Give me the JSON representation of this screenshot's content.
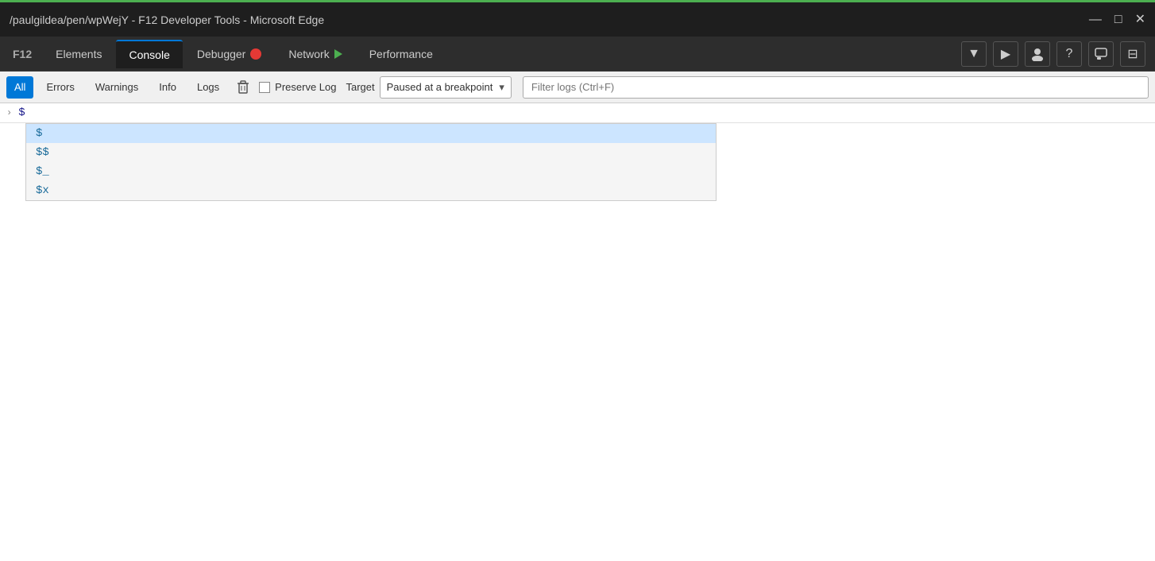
{
  "window": {
    "title": "/paulgildea/pen/wpWejY - F12 Developer Tools - Microsoft Edge",
    "controls": {
      "minimize": "—",
      "maximize": "□",
      "close": "✕"
    }
  },
  "tabs": [
    {
      "id": "f12",
      "label": "F12",
      "active": false
    },
    {
      "id": "elements",
      "label": "Elements",
      "active": false
    },
    {
      "id": "console",
      "label": "Console",
      "active": true
    },
    {
      "id": "debugger",
      "label": "Debugger",
      "active": false,
      "icon": "pause"
    },
    {
      "id": "network",
      "label": "Network",
      "active": false,
      "icon": "play"
    },
    {
      "id": "performance",
      "label": "Performance",
      "active": false
    }
  ],
  "toolbar_right": {
    "more_icon": "▼",
    "run_icon": "▶",
    "people_icon": "👤",
    "help_icon": "?",
    "feedback_icon": "💬",
    "layout_icon": "⊟"
  },
  "console_toolbar": {
    "all_label": "All",
    "errors_label": "Errors",
    "warnings_label": "Warnings",
    "info_label": "Info",
    "logs_label": "Logs",
    "clear_icon": "🗑",
    "preserve_log_label": "Preserve Log",
    "target_label": "Target",
    "target_value": "Paused at a breakpoint",
    "filter_placeholder": "Filter logs (Ctrl+F)"
  },
  "console_input": {
    "chevron": "›",
    "prompt": "$"
  },
  "autocomplete": {
    "items": [
      {
        "text": "$",
        "highlighted": true
      },
      {
        "text": "$$",
        "highlighted": false
      },
      {
        "text": "$_",
        "highlighted": false
      },
      {
        "text": "$x",
        "highlighted": false
      }
    ]
  }
}
